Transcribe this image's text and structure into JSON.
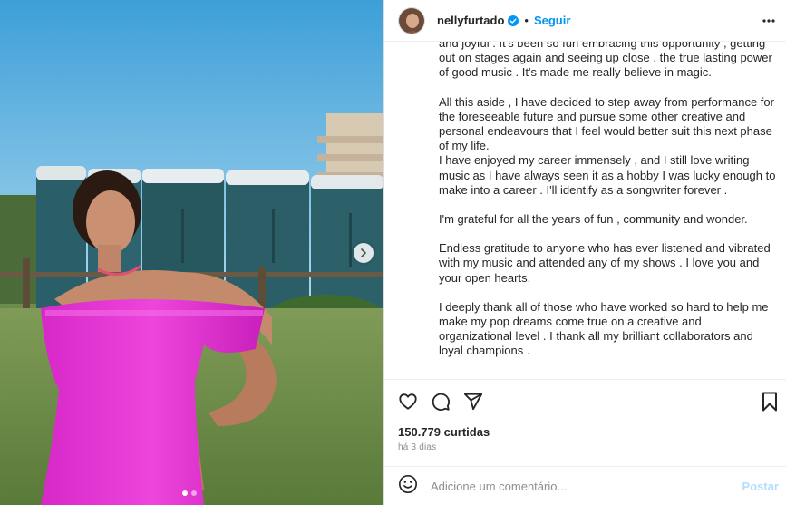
{
  "post": {
    "username": "nellyfurtado",
    "follow_label": "Seguir",
    "separator": "•",
    "caption_paragraphs": [
      "and joyful . It's been so fun embracing this opportunity , getting out on stages again and seeing up close , the true lasting power of good music . It's made me really believe in magic.",
      "All this aside , I have decided to step away from performance for the foreseeable future and pursue some other creative and personal endeavours that I feel would better suit this next phase of my life.",
      "I have enjoyed my career immensely , and I still love writing music as I have always seen it as a hobby I was lucky enough to make into a career . I'll identify as a songwriter forever .",
      "I'm grateful for all the years of fun , community and wonder.",
      "Endless gratitude to anyone who has ever listened and vibrated with my music and attended any of my shows . I love you and your open hearts.",
      "I deeply thank all of those who have worked so hard to help me make my pop dreams come true on a creative and organizational level . I thank all my brilliant collaborators and loyal champions ."
    ],
    "likes_text": "150.779 curtidas",
    "time_text": "há 3 dias"
  },
  "comment": {
    "placeholder": "Adicione um comentário...",
    "post_label": "Postar"
  },
  "carousel": {
    "slide_count": 2,
    "active_index": 0
  },
  "icons": {
    "verified": "verified-badge-icon",
    "more": "more-options-icon",
    "like": "heart-icon",
    "comment": "comment-icon",
    "share": "share-icon",
    "save": "bookmark-icon",
    "emoji": "emoji-icon",
    "next": "chevron-right-icon"
  },
  "colors": {
    "accent": "#0095f6",
    "post_disabled": "#b2dffc",
    "muted": "#8e8e8e"
  }
}
